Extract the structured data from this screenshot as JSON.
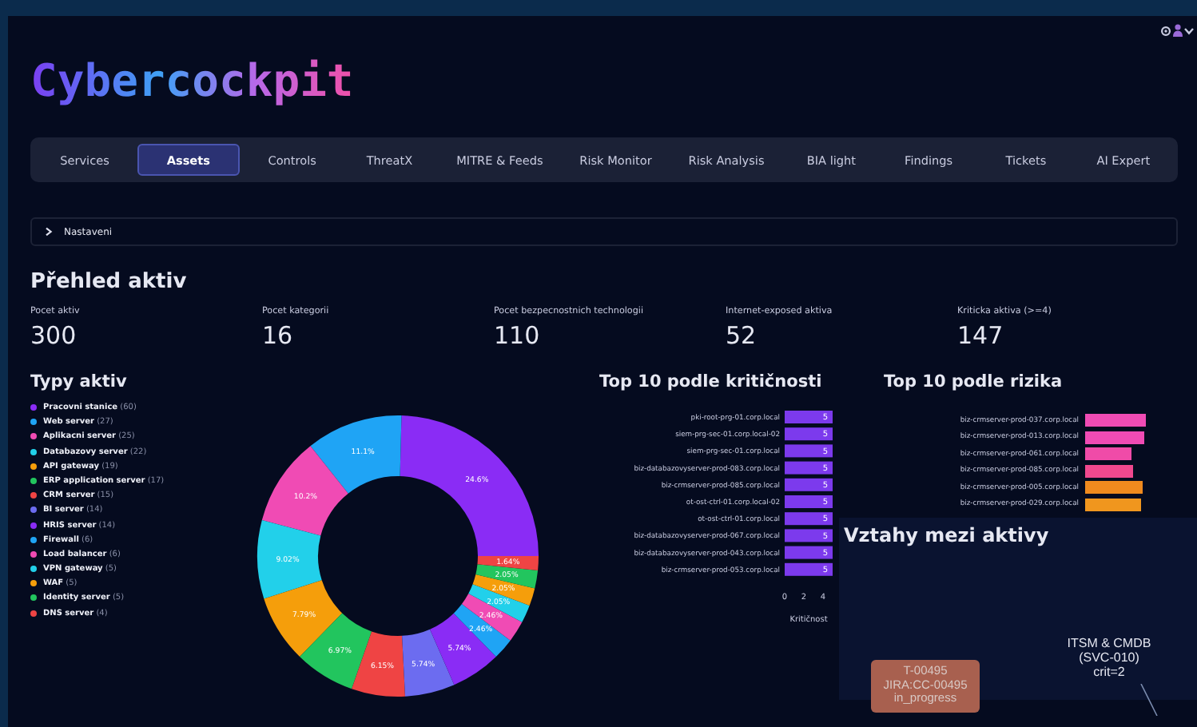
{
  "header": {
    "logo": "Cybercockpit"
  },
  "tabs": [
    {
      "label": "Services",
      "selected": false
    },
    {
      "label": "Assets",
      "selected": true
    },
    {
      "label": "Controls",
      "selected": false
    },
    {
      "label": "ThreatX",
      "selected": false
    },
    {
      "label": "MITRE & Feeds",
      "selected": false
    },
    {
      "label": "Risk Monitor",
      "selected": false
    },
    {
      "label": "Risk Analysis",
      "selected": false
    },
    {
      "label": "BIA light",
      "selected": false
    },
    {
      "label": "Findings",
      "selected": false
    },
    {
      "label": "Tickets",
      "selected": false
    },
    {
      "label": "AI Expert",
      "selected": false
    }
  ],
  "settings": {
    "label": "Nastaveni",
    "expanded": false
  },
  "overview": {
    "title": "Přehled aktiv",
    "metrics": [
      {
        "label": "Pocet aktiv",
        "value": "300"
      },
      {
        "label": "Pocet kategorii",
        "value": "16"
      },
      {
        "label": "Pocet bezpecnostnich technologii",
        "value": "110"
      },
      {
        "label": "Internet-exposed aktiva",
        "value": "52"
      },
      {
        "label": "Kriticka aktiva (>=4)",
        "value": "147"
      }
    ]
  },
  "asset_types": {
    "title": "Typy aktiv",
    "legend": [
      {
        "label": "Pracovni stanice",
        "count": "(60)",
        "color": "#8a2cf5"
      },
      {
        "label": "Web server",
        "count": "(27)",
        "color": "#1fa4f5"
      },
      {
        "label": "Aplikacni server",
        "count": "(25)",
        "color": "#f04bb4"
      },
      {
        "label": "Databazovy server",
        "count": "(22)",
        "color": "#22d0ea"
      },
      {
        "label": "API gateway",
        "count": "(19)",
        "color": "#f59e0b"
      },
      {
        "label": "ERP application server",
        "count": "(17)",
        "color": "#22c55e"
      },
      {
        "label": "CRM server",
        "count": "(15)",
        "color": "#ef4444"
      },
      {
        "label": "BI server",
        "count": "(14)",
        "color": "#6c6cf0"
      },
      {
        "label": "HRIS server",
        "count": "(14)",
        "color": "#8a2cf5"
      },
      {
        "label": "Firewall",
        "count": "(6)",
        "color": "#1fa4f5"
      },
      {
        "label": "Load balancer",
        "count": "(6)",
        "color": "#f04bb4"
      },
      {
        "label": "VPN gateway",
        "count": "(5)",
        "color": "#22d0ea"
      },
      {
        "label": "WAF",
        "count": "(5)",
        "color": "#f59e0b"
      },
      {
        "label": "Identity server",
        "count": "(5)",
        "color": "#22c55e"
      },
      {
        "label": "DNS server",
        "count": "(4)",
        "color": "#ef4444"
      }
    ],
    "chart_data": {
      "type": "donut",
      "values": [
        24.6,
        11.1,
        10.2,
        9.02,
        7.79,
        6.97,
        6.15,
        5.74,
        5.74,
        2.46,
        2.46,
        2.05,
        2.05,
        2.05,
        1.64
      ],
      "value_labels": [
        "24.6%",
        "11.1%",
        "10.2%",
        "9.02%",
        "7.79%",
        "6.97%",
        "6.15%",
        "5.74%",
        "5.74%",
        "2.46%",
        "2.46%",
        "2.05%",
        "2.05%",
        "2.05%",
        "1.64%"
      ]
    }
  },
  "top_criticality": {
    "title": "Top 10 podle kritičnosti",
    "chart_data": {
      "type": "bar",
      "orientation": "horizontal",
      "xlabel": "Kritičnost",
      "categories": [
        "pki-root-prg-01.corp.local",
        "siem-prg-sec-01.corp.local-02",
        "siem-prg-sec-01.corp.local",
        "biz-databazovyserver-prod-083.corp.local",
        "biz-crmserver-prod-085.corp.local",
        "ot-ost-ctrl-01.corp.local-02",
        "ot-ost-ctrl-01.corp.local",
        "biz-databazovyserver-prod-067.corp.local",
        "biz-databazovyserver-prod-043.corp.local",
        "biz-crmserver-prod-053.corp.local"
      ],
      "values": [
        5,
        5,
        5,
        5,
        5,
        5,
        5,
        5,
        5,
        5
      ],
      "xticks": [
        0,
        2,
        4
      ],
      "xlim": [
        0,
        5
      ],
      "data_labels": true,
      "color": "#7c3aed"
    }
  },
  "top_risk": {
    "title": "Top 10 podle rizika",
    "items": [
      {
        "label": "biz-crmserver-prod-037.corp.local",
        "color": "#f04bb4"
      },
      {
        "label": "biz-crmserver-prod-013.corp.local",
        "color": "#f04bb4"
      },
      {
        "label": "biz-crmserver-prod-061.corp.local",
        "color": "#f04ba8"
      },
      {
        "label": "biz-crmserver-prod-085.corp.local",
        "color": "#f0488e"
      },
      {
        "label": "biz-crmserver-prod-005.corp.local",
        "color": "#f08a1e"
      },
      {
        "label": "biz-crmserver-prod-029.corp.local",
        "color": "#f0961e"
      }
    ]
  },
  "relations": {
    "title": "Vztahy mezi aktivy",
    "nodes": [
      {
        "kind": "box",
        "lines": [
          "T-00495",
          "JIRA:CC-00495",
          "in_progress"
        ]
      },
      {
        "kind": "label",
        "lines": [
          "ITSM & CMDB",
          "(SVC-010)",
          "crit=2"
        ]
      }
    ]
  }
}
